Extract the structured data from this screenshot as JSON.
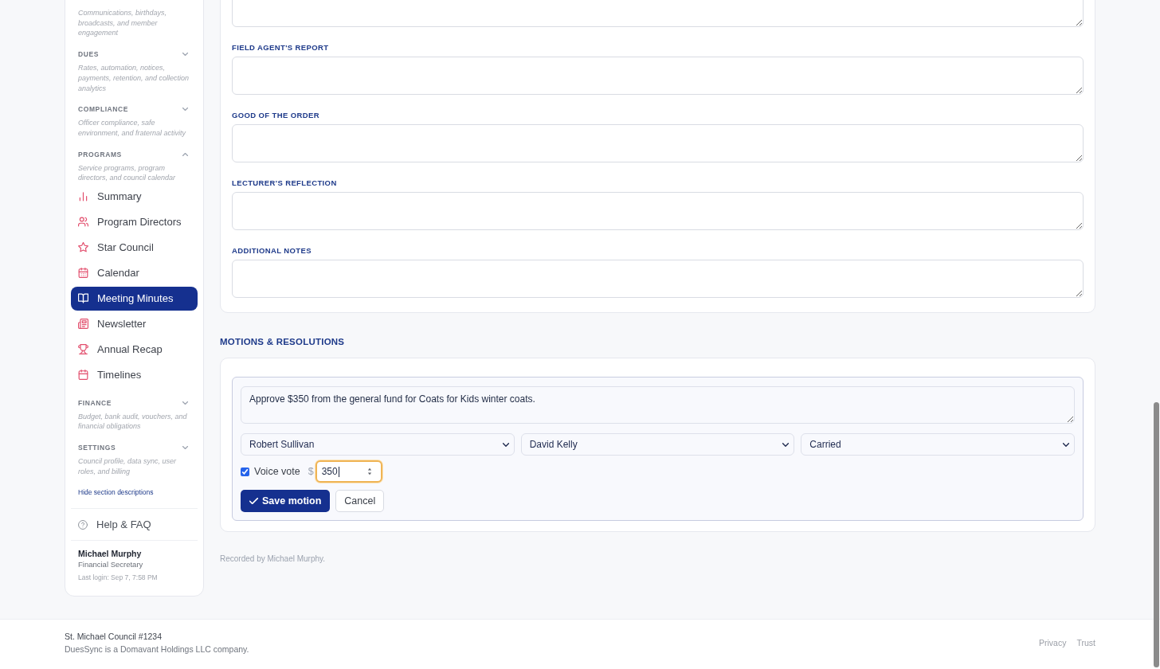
{
  "sidebar": {
    "groups": [
      {
        "description": "Communications, birthdays, broadcasts, and member engagement"
      },
      {
        "title": "DUES",
        "expanded": false,
        "description": "Rates, automation, notices, payments, retention, and collection analytics"
      },
      {
        "title": "COMPLIANCE",
        "expanded": false,
        "description": "Officer compliance, safe environment, and fraternal activity"
      },
      {
        "title": "PROGRAMS",
        "expanded": true,
        "description": "Service programs, program directors, and council calendar",
        "items": [
          {
            "label": "Summary",
            "selected": false
          },
          {
            "label": "Program Directors",
            "selected": false
          },
          {
            "label": "Star Council",
            "selected": false
          },
          {
            "label": "Calendar",
            "selected": false
          },
          {
            "label": "Meeting Minutes",
            "selected": true
          },
          {
            "label": "Newsletter",
            "selected": false
          },
          {
            "label": "Annual Recap",
            "selected": false
          },
          {
            "label": "Timelines",
            "selected": false
          }
        ]
      },
      {
        "title": "FINANCE",
        "expanded": false,
        "description": "Budget, bank audit, vouchers, and financial obligations"
      },
      {
        "title": "SETTINGS",
        "expanded": false,
        "description": "Council profile, data sync, user roles, and billing"
      }
    ],
    "descriptions_link": "Hide section descriptions",
    "help": "Help & FAQ",
    "user": {
      "name": "Michael Murphy",
      "role": "Financial Secretary",
      "last_login": "Last login: Sep 7, 7:58 PM"
    }
  },
  "minutes": {
    "fields": [
      {
        "label": "FIELD AGENT'S REPORT"
      },
      {
        "label": "GOOD OF THE ORDER"
      },
      {
        "label": "LECTURER'S REFLECTION"
      },
      {
        "label": "ADDITIONAL NOTES"
      }
    ]
  },
  "motions": {
    "title": "MOTIONS & RESOLUTIONS",
    "form": {
      "text": "Approve $350 from the general fund for Coats for Kids winter coats.",
      "selects": [
        "Robert Sullivan",
        "David Kelly",
        "Carried"
      ],
      "voice_vote": {
        "label": "Voice vote",
        "checked": true
      },
      "currency": "$",
      "amount": {
        "value": "350",
        "focused": true
      },
      "save": "Save motion",
      "cancel": "Cancel"
    },
    "recorded_by": "Recorded by Michael Murphy."
  },
  "footer": {
    "council": "St. Michael Council #1234",
    "company": "DuesSync is a Domavant Holdings LLC company.",
    "links": [
      "Privacy",
      "Trust"
    ]
  }
}
